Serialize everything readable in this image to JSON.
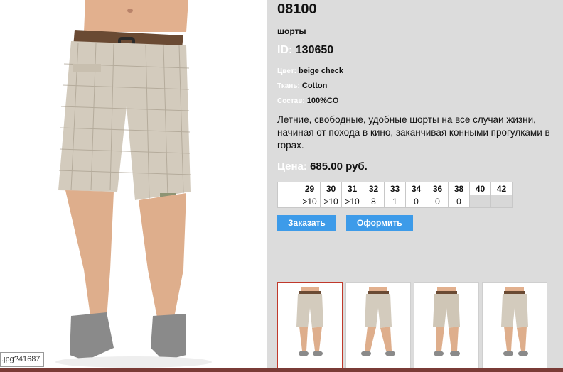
{
  "product": {
    "model": "08100",
    "subtitle": "шорты",
    "id_label": "ID:",
    "id_value": "130650",
    "attributes": [
      {
        "label": "Цвет:",
        "value": "beige check"
      },
      {
        "label": "Ткань:",
        "value": "Cotton"
      },
      {
        "label": "Состав:",
        "value": "100%CO"
      }
    ],
    "description": "Летние, свободные, удобные шорты на все случаи жизни, начиная от похода в кино, заканчивая конными прогулками в горах.",
    "price_label": "Цена:",
    "price_value": "685.00 руб."
  },
  "sizes": {
    "headers": [
      "29",
      "30",
      "31",
      "32",
      "33",
      "34",
      "36",
      "38",
      "40",
      "42"
    ],
    "stock": [
      ">10",
      ">10",
      ">10",
      "8",
      "1",
      "0",
      "0",
      "0",
      "",
      ""
    ]
  },
  "buttons": {
    "order": "Заказать",
    "checkout": "Оформить"
  },
  "tooltip": ".jpg?41687",
  "colors": {
    "panel_bg": "#dcdcdc",
    "button_bg": "#3d9be9",
    "active_thumb_border": "#c0392b"
  }
}
